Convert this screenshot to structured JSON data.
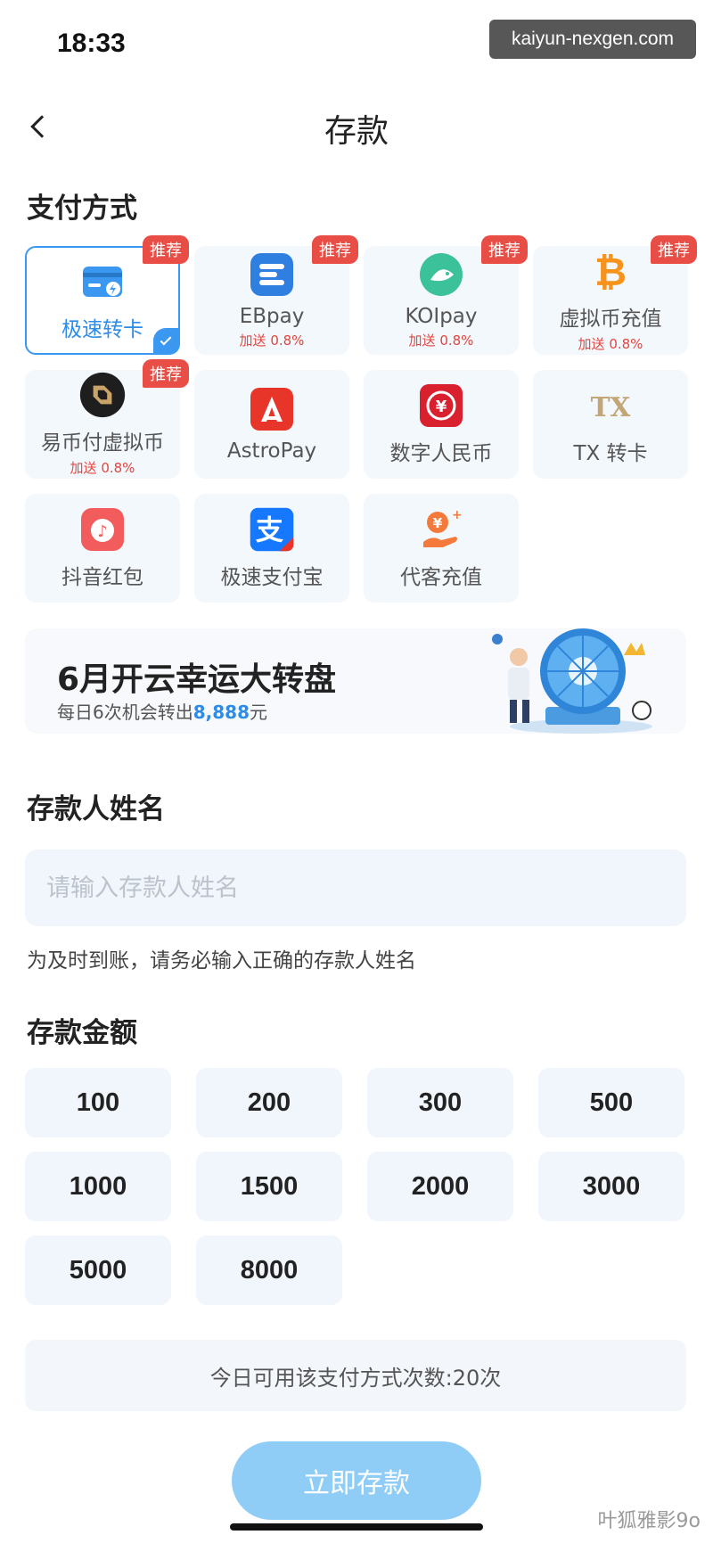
{
  "status_bar": {
    "time": "18:33"
  },
  "watermark_top": "kaiyun-nexgen.com",
  "header": {
    "title": "存款"
  },
  "payment": {
    "section_title": "支付方式",
    "methods": [
      {
        "label": "极速转卡",
        "bonus": "",
        "badge": "推荐",
        "selected": true,
        "icon": "card-lightning-icon"
      },
      {
        "label": "EBpay",
        "bonus": "加送 0.8%",
        "badge": "推荐",
        "selected": false,
        "icon": "ebpay-icon"
      },
      {
        "label": "KOIpay",
        "bonus": "加送 0.8%",
        "badge": "推荐",
        "selected": false,
        "icon": "koi-fish-icon"
      },
      {
        "label": "虚拟币充值",
        "bonus": "加送 0.8%",
        "badge": "推荐",
        "selected": false,
        "icon": "bitcoin-icon"
      },
      {
        "label": "易币付虚拟币",
        "bonus": "加送 0.8%",
        "badge": "推荐",
        "selected": false,
        "icon": "yibifu-icon"
      },
      {
        "label": "AstroPay",
        "bonus": "",
        "badge": "",
        "selected": false,
        "icon": "astropay-icon"
      },
      {
        "label": "数字人民币",
        "bonus": "",
        "badge": "",
        "selected": false,
        "icon": "digital-yuan-icon"
      },
      {
        "label": "TX 转卡",
        "bonus": "",
        "badge": "",
        "selected": false,
        "icon": "tx-icon"
      },
      {
        "label": "抖音红包",
        "bonus": "",
        "badge": "",
        "selected": false,
        "icon": "douyin-redpacket-icon"
      },
      {
        "label": "极速支付宝",
        "bonus": "",
        "badge": "",
        "selected": false,
        "icon": "alipay-icon"
      },
      {
        "label": "代客充值",
        "bonus": "",
        "badge": "",
        "selected": false,
        "icon": "agent-topup-icon"
      }
    ]
  },
  "banner": {
    "title": "6月开云幸运大转盘",
    "subtitle_prefix": "每日6次机会转出",
    "subtitle_amount": "8,888",
    "subtitle_suffix": "元"
  },
  "depositor": {
    "section_title": "存款人姓名",
    "placeholder": "请输入存款人姓名",
    "value": "",
    "hint": "为及时到账，请务必输入正确的存款人姓名"
  },
  "amount": {
    "section_title": "存款金额",
    "options": [
      "100",
      "200",
      "300",
      "500",
      "1000",
      "1500",
      "2000",
      "3000",
      "5000",
      "8000"
    ]
  },
  "usage_text": "今日可用该支付方式次数:20次",
  "submit_label": "立即存款",
  "watermark_bottom": "叶狐雅影9o",
  "colors": {
    "accent": "#3b98f0",
    "badge": "#e94e46",
    "submit": "#8fccf6"
  }
}
